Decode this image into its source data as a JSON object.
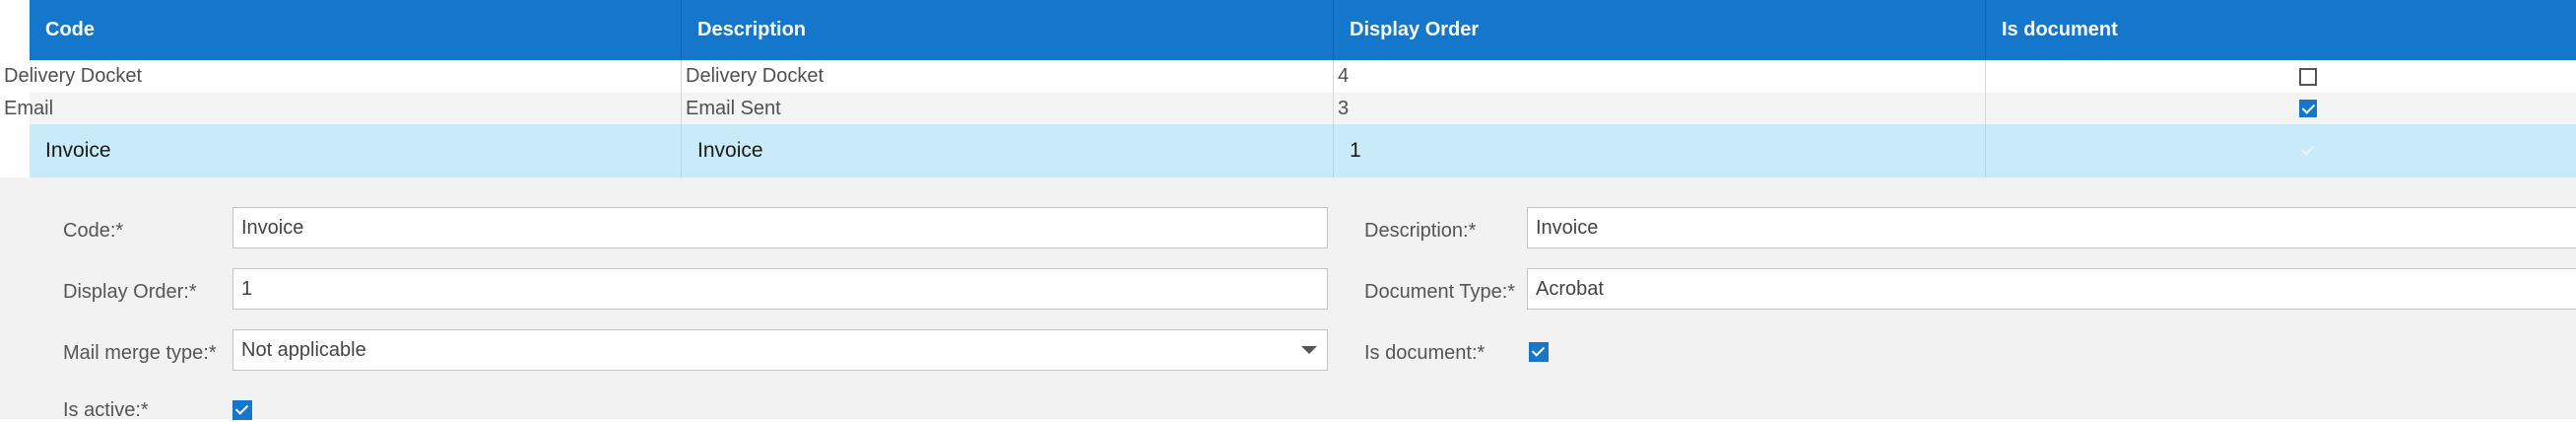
{
  "columns": {
    "code": "Code",
    "description": "Description",
    "display_order": "Display Order",
    "is_document": "Is document"
  },
  "rows": [
    {
      "code": "Delivery Docket",
      "description": "Delivery Docket",
      "display_order": "4",
      "is_document": false
    },
    {
      "code": "Email",
      "description": "Email Sent",
      "display_order": "3",
      "is_document": true
    },
    {
      "code": "Invoice",
      "description": "Invoice",
      "display_order": "1",
      "is_document": true,
      "selected": true
    }
  ],
  "form": {
    "code_label": "Code:",
    "code_value": "Invoice",
    "description_label": "Description:",
    "description_value": "Invoice",
    "display_order_label": "Display Order:",
    "display_order_value": "1",
    "document_type_label": "Document Type:",
    "document_type_value": "Acrobat",
    "mail_merge_label": "Mail merge type:",
    "mail_merge_value": "Not applicable",
    "is_document_label": "Is document:",
    "is_document_checked": true,
    "is_active_label": "Is active:",
    "is_active_checked": true,
    "required_marker": "*"
  },
  "colors": {
    "header_bg": "#1477cc",
    "selected_row_bg": "#c8eaf9",
    "form_bg": "#f2f2f2",
    "checkbox_on": "#1477cc"
  }
}
